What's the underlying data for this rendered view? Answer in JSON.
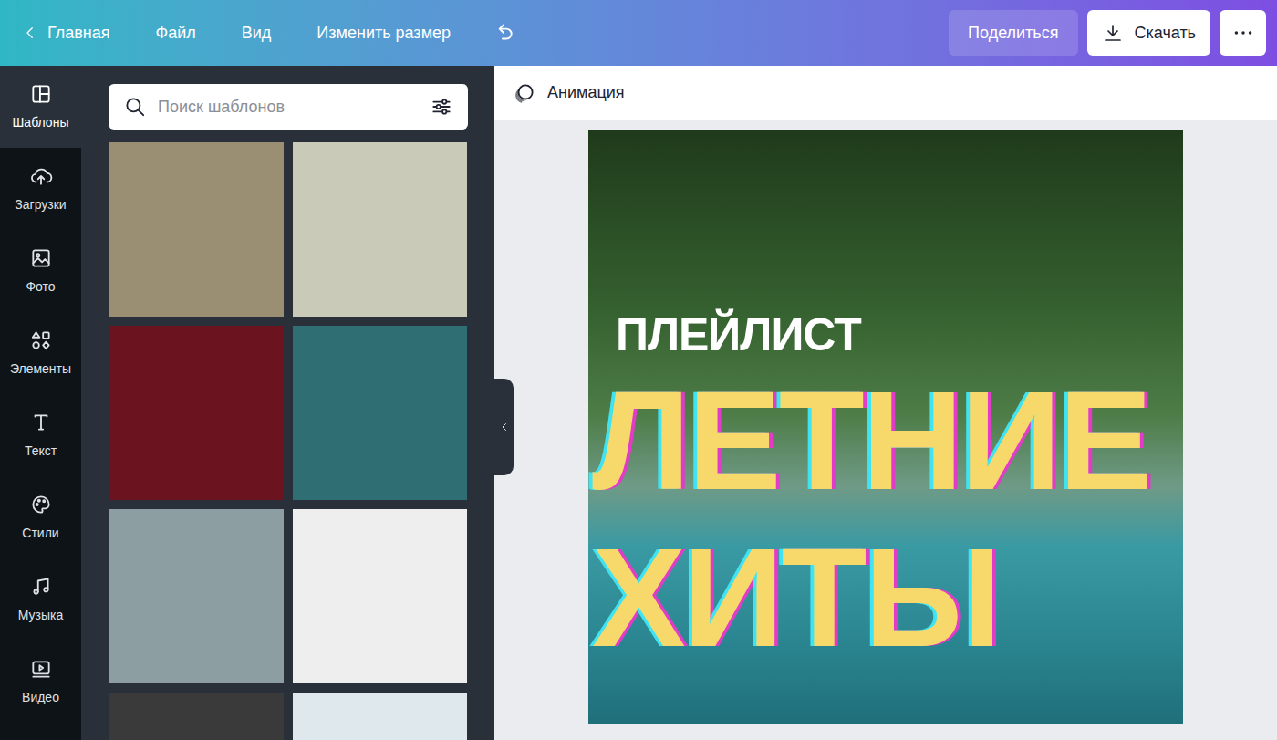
{
  "topbar": {
    "back": "Главная",
    "menu": [
      "Файл",
      "Вид",
      "Изменить размер"
    ],
    "share": "Поделиться",
    "download": "Скачать"
  },
  "rail": [
    {
      "label": "Шаблоны",
      "selected": true
    },
    {
      "label": "Загрузки",
      "selected": false
    },
    {
      "label": "Фото",
      "selected": false
    },
    {
      "label": "Элементы",
      "selected": false
    },
    {
      "label": "Текст",
      "selected": false
    },
    {
      "label": "Стили",
      "selected": false
    },
    {
      "label": "Музыка",
      "selected": false
    },
    {
      "label": "Видео",
      "selected": false
    }
  ],
  "search": {
    "placeholder": "Поиск шаблонов"
  },
  "templates": [
    {
      "color": "#9a8f72"
    },
    {
      "color": "#c9cbb8"
    },
    {
      "color": "#6b1420"
    },
    {
      "color": "#2f6f73"
    },
    {
      "color": "#8d9ea3"
    },
    {
      "color": "#eeeeee"
    },
    {
      "color": "#3a3a3a"
    },
    {
      "color": "#dfe8ec"
    }
  ],
  "toolbar": {
    "animation": "Анимация"
  },
  "canvas": {
    "kicker": "ПЛЕЙЛИСТ",
    "lines": [
      "ЛЕТНИЕ",
      "ХИТЫ"
    ]
  }
}
